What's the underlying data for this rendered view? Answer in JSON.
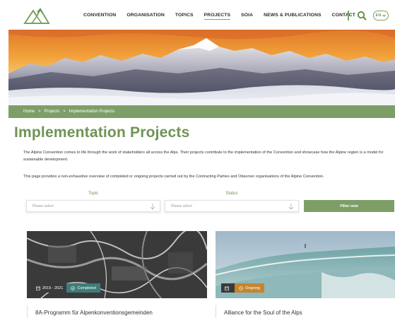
{
  "nav": {
    "items": [
      {
        "label": "CONVENTION",
        "active": false
      },
      {
        "label": "ORGANISATION",
        "active": false
      },
      {
        "label": "TOPICS",
        "active": false
      },
      {
        "label": "PROJECTS",
        "active": true
      },
      {
        "label": "SOIA",
        "active": false
      },
      {
        "label": "NEWS & PUBLICATIONS",
        "active": false
      },
      {
        "label": "CONTACT",
        "active": false
      }
    ],
    "search_icon": "search-icon",
    "language": "EN"
  },
  "breadcrumb": {
    "items": [
      "Home",
      ">",
      "Projects",
      ">",
      "Implementation Projects"
    ]
  },
  "page": {
    "title": "Implementation Projects",
    "intro": "The Alpine Convention comes to life through the work of stakeholders all across the Alps. Their projects contribute to the implementation of the Convention and showcase how the Alpine region is a model for sustainable development.",
    "overview": "This page provides a non-exhaustive overview of completed or ongoing projects carried out by the Contracting Parties and Observer organisations of the Alpine Convention."
  },
  "filters": {
    "topic_label": "Topic",
    "topic_placeholder": "Please select",
    "status_label": "Status",
    "status_placeholder": "Please select",
    "button": "Filter now"
  },
  "cards": [
    {
      "date": "2019 - 2021",
      "status": "Completed",
      "status_color": "#3f7c78",
      "title": "8A-Programm für Alpenkonventionsgemeinden"
    },
    {
      "date": "",
      "status": "Ongoing",
      "status_color": "#c6842f",
      "title": "Alliance for the Soul of the Alps"
    }
  ],
  "colors": {
    "accent": "#7e9e68",
    "title": "#6f9355"
  }
}
